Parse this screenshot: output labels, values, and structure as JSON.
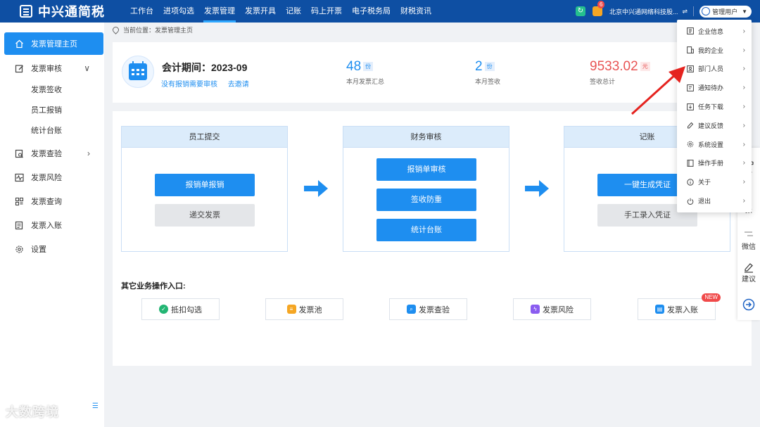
{
  "app": {
    "title": "中兴通简税"
  },
  "nav": [
    {
      "label": "工作台"
    },
    {
      "label": "进项勾选"
    },
    {
      "label": "发票管理"
    },
    {
      "label": "发票开具"
    },
    {
      "label": "记账"
    },
    {
      "label": "码上开票"
    },
    {
      "label": "电子税务局"
    },
    {
      "label": "财税资讯"
    }
  ],
  "header": {
    "notification_count": "6",
    "company": "北京中兴通网络科技股...",
    "user": "管理用户"
  },
  "sidebar": {
    "items": [
      {
        "label": "发票管理主页",
        "icon": "home-icon"
      },
      {
        "label": "发票审核",
        "icon": "edit-icon"
      },
      {
        "label": "发票签收"
      },
      {
        "label": "员工报销"
      },
      {
        "label": "统计台账"
      },
      {
        "label": "发票查验",
        "icon": "search-doc-icon"
      },
      {
        "label": "发票风险",
        "icon": "pulse-icon"
      },
      {
        "label": "发票查询",
        "icon": "grid-icon"
      },
      {
        "label": "发票入账",
        "icon": "ledger-icon"
      },
      {
        "label": "设置",
        "icon": "gear-icon"
      }
    ]
  },
  "breadcrumb": {
    "prefix": "当前位置：",
    "current": "发票管理主页"
  },
  "stats": {
    "period": "会计期间：2023-09",
    "link_unreviewed": "没有报销需要审核",
    "link_invite": "去邀请",
    "items": [
      {
        "value": "48",
        "unit": "份",
        "label": "本月发票汇总"
      },
      {
        "value": "2",
        "unit": "份",
        "label": "本月签收"
      },
      {
        "value": "9533.02",
        "unit": "元",
        "label": "签收总计"
      }
    ]
  },
  "flow": [
    {
      "title": "员工提交",
      "buttons": [
        "报销单报销",
        "递交发票"
      ]
    },
    {
      "title": "财务审核",
      "buttons": [
        "报销单审核",
        "签收防重",
        "统计台账"
      ]
    },
    {
      "title": "记账",
      "buttons": [
        "一键生成凭证",
        "手工录入凭证"
      ]
    }
  ],
  "other": {
    "title": "其它业务操作入口:",
    "items": [
      {
        "label": "抵扣勾选",
        "color": "#22b573"
      },
      {
        "label": "发票池",
        "color": "#f5a623"
      },
      {
        "label": "发票查验",
        "color": "#1e8ef0"
      },
      {
        "label": "发票风险",
        "color": "#8a5cf0"
      },
      {
        "label": "发票入账",
        "color": "#1e8ef0",
        "badge": "NEW"
      }
    ]
  },
  "float_panel": [
    {
      "label": "话"
    },
    {
      "label": "报"
    },
    {
      "label": "微信"
    },
    {
      "label": "建议"
    }
  ],
  "dropdown": [
    {
      "label": "企业信息"
    },
    {
      "label": "我的企业"
    },
    {
      "label": "部门人员"
    },
    {
      "label": "通知待办"
    },
    {
      "label": "任务下载"
    },
    {
      "label": "建议反馈"
    },
    {
      "label": "系统设置"
    },
    {
      "label": "操作手册"
    },
    {
      "label": "关于"
    },
    {
      "label": "退出"
    }
  ],
  "watermark": "大数跨境",
  "colors": {
    "primary": "#1e8ef0",
    "topbar": "#0e4fa3",
    "amount": "#e85555"
  }
}
